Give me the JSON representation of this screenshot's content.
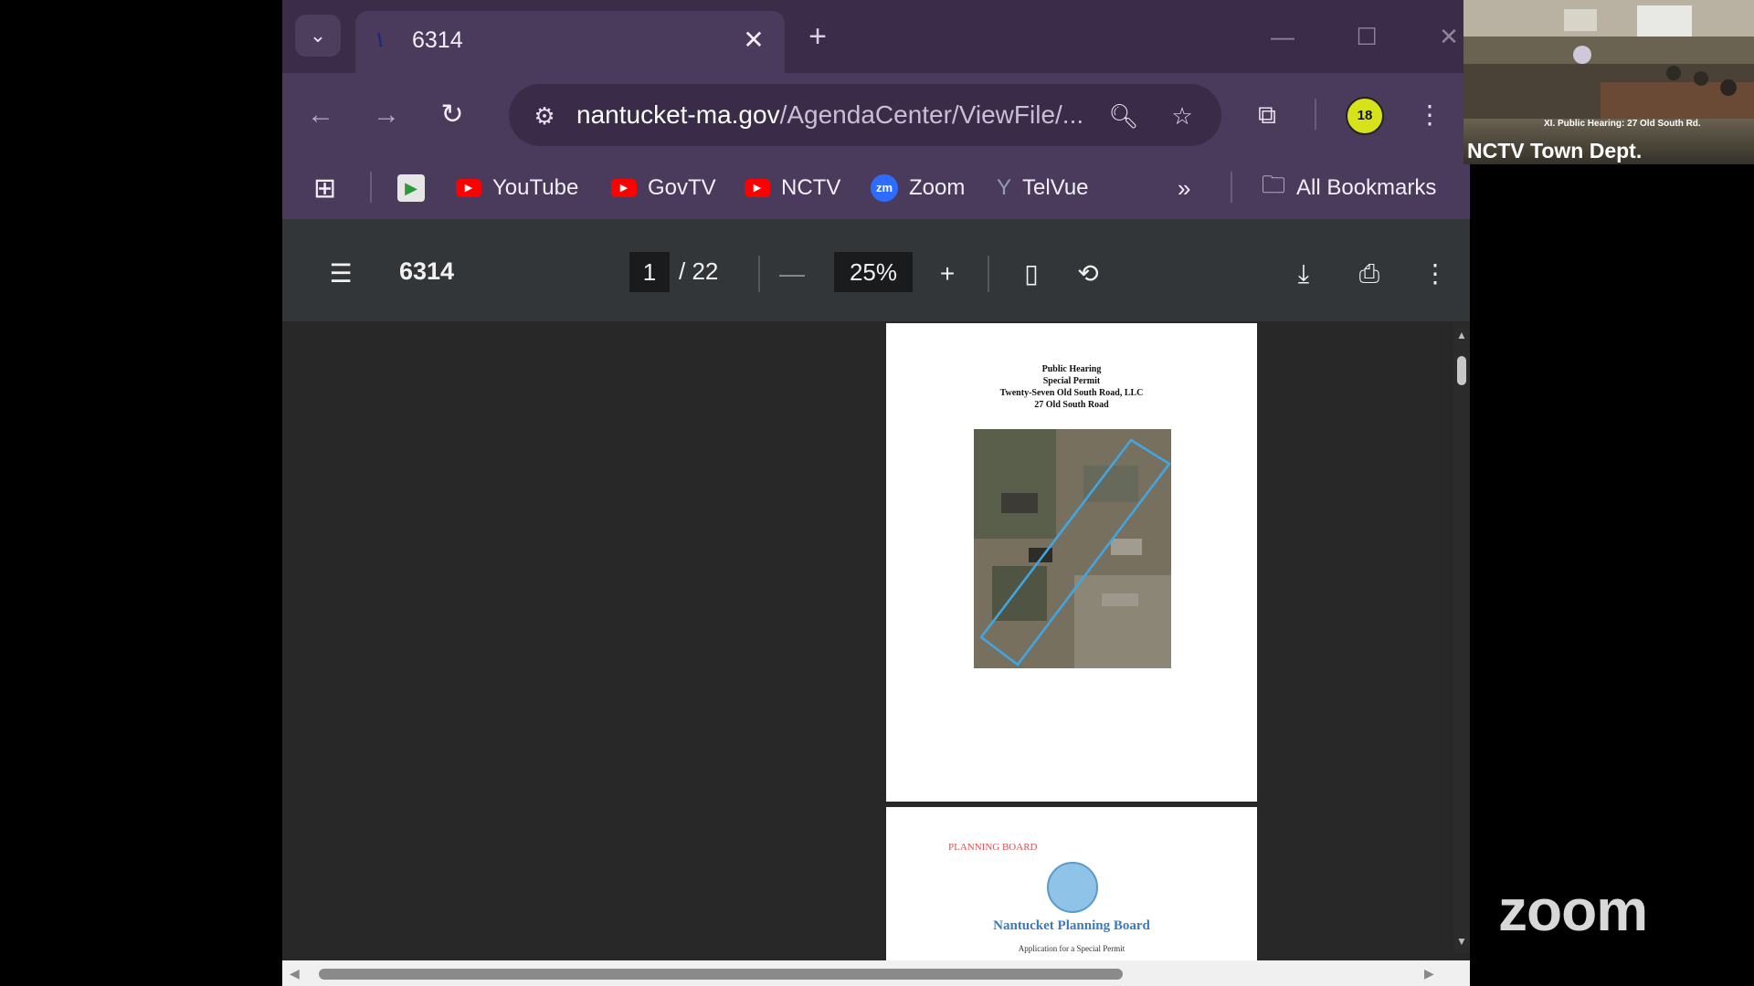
{
  "tab": {
    "title": "6314"
  },
  "address_bar": {
    "host": "nantucket-ma.gov",
    "path": "/AgendaCenter/ViewFile/..."
  },
  "profile": {
    "label": "18"
  },
  "bookmarks": {
    "items": [
      {
        "label": "YouTube",
        "icon": "youtube-icon"
      },
      {
        "label": "GovTV",
        "icon": "youtube-icon"
      },
      {
        "label": "NCTV",
        "icon": "youtube-icon"
      },
      {
        "label": "Zoom",
        "icon": "zoom-icon"
      },
      {
        "label": "TelVue",
        "icon": "telvue-icon"
      }
    ],
    "all_bookmarks": "All Bookmarks"
  },
  "pdf": {
    "title": "6314",
    "current_page": "1",
    "total_pages": "/ 22",
    "zoom": "25%",
    "page1": {
      "line1": "Public Hearing",
      "line2": "Special Permit",
      "line3": "Twenty-Seven Old South Road, LLC",
      "line4": "27 Old South Road"
    },
    "page2": {
      "stamp": "PLANNING BOARD",
      "title": "Nantucket Planning Board",
      "subtitle": "Application for a Special Permit"
    }
  },
  "video": {
    "lower_third": "XI. Public Hearing: 27 Old South Rd.",
    "name": "NCTV Town Dept."
  },
  "zoom_logo": "zoom"
}
